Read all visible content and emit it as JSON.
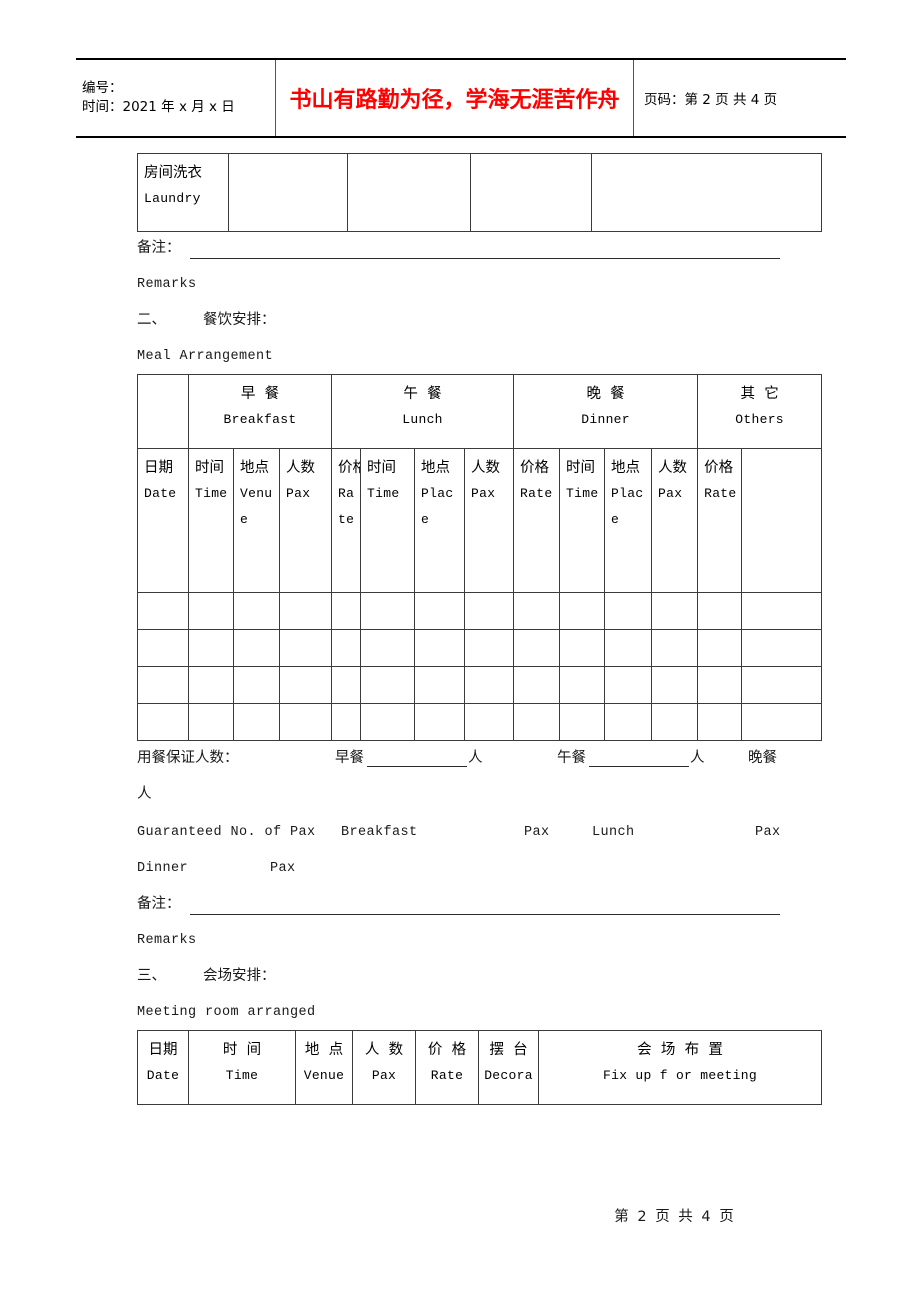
{
  "header": {
    "id_label": "编号：",
    "time_label": "时间：2021 年 x 月 x 日",
    "slogan": "书山有路勤为径，学海无涯苦作舟",
    "page_label": "页码：第 2 页  共 4 页",
    "slogan_color": "#ff0000"
  },
  "laundry_table": {
    "row": {
      "label_cn": "房间洗衣",
      "label_en": "Laundry",
      "cells": [
        "",
        "",
        "",
        ""
      ]
    }
  },
  "remarks_1": {
    "label_cn": "备注：",
    "label_en": "Remarks"
  },
  "section_2": {
    "number_cn": "二、",
    "title_cn": "餐饮安排：",
    "title_en": "Meal Arrangement"
  },
  "meal_table": {
    "group_headers": [
      {
        "cn": "早  餐",
        "en": "Breakfast"
      },
      {
        "cn": "午  餐",
        "en": "Lunch"
      },
      {
        "cn": "晚  餐",
        "en": "Dinner"
      },
      {
        "cn": "其  它",
        "en": "Others"
      }
    ],
    "column_headers": [
      {
        "cn": "日期",
        "en": "Date"
      },
      {
        "cn": "时间",
        "en": "Time"
      },
      {
        "cn": "地点",
        "en": "Venue"
      },
      {
        "cn": "人数",
        "en": "Pax"
      },
      {
        "cn": "价格",
        "en": "Rate"
      },
      {
        "cn": "时间",
        "en": "Time"
      },
      {
        "cn": "地点",
        "en": "Place"
      },
      {
        "cn": "人数",
        "en": "Pax"
      },
      {
        "cn": "价格",
        "en": "Rate"
      },
      {
        "cn": "时间",
        "en": "Time"
      },
      {
        "cn": "地点",
        "en": "Place"
      },
      {
        "cn": "人数",
        "en": "Pax"
      },
      {
        "cn": "价格",
        "en": "Rate"
      },
      {
        "cn": "",
        "en": ""
      }
    ],
    "empty_row_count": 4,
    "column_count": 14
  },
  "guarantee": {
    "label_cn": "用餐保证人数：",
    "breakfast_cn": "早餐",
    "lunch_cn": "午餐",
    "dinner_cn": "晚餐",
    "pax_cn": "人",
    "pax_cn_wrap": "人",
    "label_en": "Guaranteed No. of Pax",
    "breakfast_en": "Breakfast",
    "lunch_en": "Lunch",
    "dinner_en": "Dinner",
    "pax_en": "Pax"
  },
  "remarks_2": {
    "label_cn": "备注：",
    "label_en": "Remarks"
  },
  "section_3": {
    "number_cn": "三、",
    "title_cn": "会场安排：",
    "title_en": "Meeting room arranged"
  },
  "meeting_table": {
    "column_headers": [
      {
        "cn": "日期",
        "en": "Date"
      },
      {
        "cn": "时  间",
        "en": "Time"
      },
      {
        "cn": "地  点",
        "en": "Venue"
      },
      {
        "cn": "人  数",
        "en": "Pax"
      },
      {
        "cn": "价  格",
        "en": "Rate"
      },
      {
        "cn": "摆  台",
        "en": "Decora"
      },
      {
        "cn": "会  场  布  置",
        "en": "Fix up f or meeting"
      }
    ]
  },
  "footer": {
    "page_text": "第 2 页 共 4 页"
  }
}
